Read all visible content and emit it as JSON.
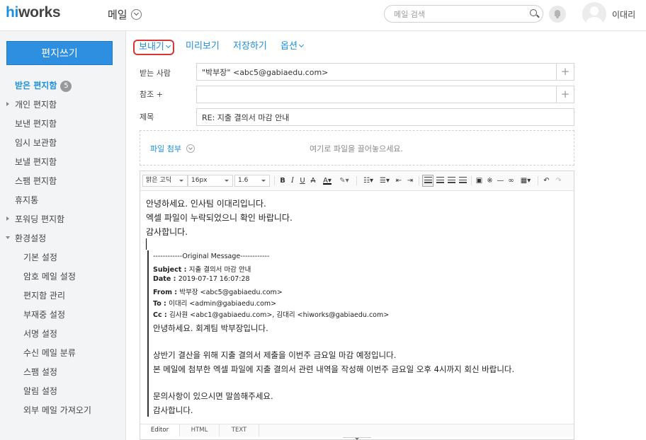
{
  "header": {
    "logo_hi": "hi",
    "logo_rest": "works",
    "app_title": "메일",
    "search_placeholder": "메일 검색",
    "username": "이대리"
  },
  "sidebar": {
    "compose_label": "편지쓰기",
    "inbox_label": "받은 편지함",
    "inbox_count": "5",
    "items": [
      "개인 편지함",
      "보낸 편지함",
      "임시 보관함",
      "보낼 편지함",
      "스팸 편지함",
      "휴지통",
      "포워딩 편지함",
      "환경설정"
    ],
    "settings_items": [
      "기본 설정",
      "암호 메일 설정",
      "편지함 관리",
      "부재중 설정",
      "서명 설정",
      "수신 메일 분류",
      "스팸 설정",
      "알림 설정",
      "외부 메일 가져오기"
    ]
  },
  "actions": {
    "send": "보내기",
    "preview": "미리보기",
    "save": "저장하기",
    "options": "옵션"
  },
  "form": {
    "to_label": "받는 사람",
    "to_value": "\"박부장\" <abc5@gabiaedu.com>",
    "cc_label": "참조 +",
    "cc_value": "",
    "subject_label": "제목",
    "subject_value": "RE: 지출 결의서 마감 안내",
    "attach_label": "파일 첨부",
    "attach_hint": "여기로 파일을 끌어놓으세요."
  },
  "toolbar": {
    "font": "맑은 고딕",
    "size": "16px",
    "line_height": "1.6"
  },
  "editor": {
    "body_lines": [
      "안녕하세요. 인사팀 이대리입니다.",
      "엑셀 파일이 누락되었으니 확인 바랍니다.",
      "감사합니다."
    ],
    "original_divider": "------------Original Message------------",
    "subject_key": "Subject : ",
    "subject_val": "지출 결의서 마감 안내",
    "date_key": "Date : ",
    "date_val": "2019-07-17 16:07:28",
    "from_key": "From : ",
    "from_val": "박부장 <abc5@gabiaedu.com>",
    "to_key": "To : ",
    "to_val": "이대리 <admin@gabiaedu.com>",
    "cc_key": "Cc : ",
    "cc_val": "김사원 <abc1@gabiaedu.com>, 김대리 <hiworks@gabiaedu.com>",
    "quoted_lines": [
      "안녕하세요. 회계팀 박부장입니다.",
      "상반기 결산을 위해 지출 결의서 제출을 이번주 금요일 마감 예정입니다.",
      "본 메일에 첨부한 엑셀 파일에 지출 결의서 관련 내역을 작성해 이번주 금요일 오후 4시까지 회신 바랍니다.",
      "문의사항이 있으시면 말씀해주세요.",
      "감사합니다."
    ],
    "tabs": [
      "Editor",
      "HTML",
      "TEXT"
    ]
  }
}
